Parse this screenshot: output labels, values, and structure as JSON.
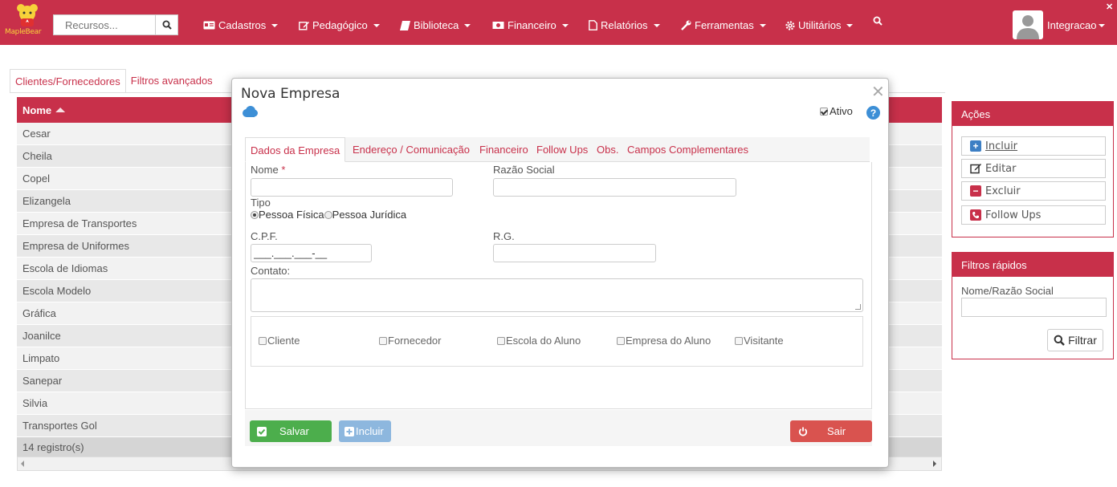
{
  "brand": {
    "logo_text": "MapleBear"
  },
  "navbar": {
    "search_placeholder": "Recursos...",
    "menus": [
      "Cadastros",
      "Pedagógico",
      "Biblioteca",
      "Financeiro",
      "Relatórios",
      "Ferramentas",
      "Utilitários"
    ],
    "user_name": "Integracao",
    "close_glyph": "✕"
  },
  "page": {
    "tabs": [
      "Clientes/Fornecedores",
      "Filtros avançados"
    ],
    "table": {
      "header": "Nome",
      "rows": [
        "Cesar",
        "Cheila",
        "Copel",
        "Elizangela",
        "Empresa de Transportes",
        "Empresa de Uniformes",
        "Escola de Idiomas",
        "Escola Modelo",
        "Gráfica",
        "Joanilce",
        "Limpato",
        "Sanepar",
        "Silvia",
        "Transportes Gol"
      ],
      "footer": "14 registro(s)"
    }
  },
  "actions_panel": {
    "title": "Ações",
    "buttons": [
      "Incluir",
      "Editar",
      "Excluir",
      "Follow Ups"
    ]
  },
  "filters_panel": {
    "title": "Filtros rápidos",
    "field_label": "Nome/Razão Social",
    "button": "Filtrar"
  },
  "modal": {
    "title": "Nova Empresa",
    "ativo_label": "Ativo",
    "ativo_checked": true,
    "tabs": [
      "Dados da Empresa",
      "Endereço / Comunicação",
      "Financeiro",
      "Follow Ups",
      "Obs.",
      "Campos Complementares"
    ],
    "fields": {
      "nome_label": "Nome",
      "razao_label": "Razão Social",
      "tipo_label": "Tipo",
      "tipo_options": [
        "Pessoa Física",
        "Pessoa Jurídica"
      ],
      "tipo_selected": "Pessoa Física",
      "cpf_label": "C.P.F.",
      "cpf_value": "___.___.___-__",
      "rg_label": "R.G.",
      "contato_label": "Contato:"
    },
    "types": [
      "Cliente",
      "Fornecedor",
      "Escola do Aluno",
      "Empresa do Aluno",
      "Visitante"
    ],
    "buttons": {
      "save": "Salvar",
      "include": "Incluir",
      "exit": "Sair"
    }
  },
  "colors": {
    "primary": "#c8304a",
    "success": "#4cae4c",
    "info": "#8db7de",
    "danger": "#d9534f",
    "help": "#3d8fd6"
  }
}
